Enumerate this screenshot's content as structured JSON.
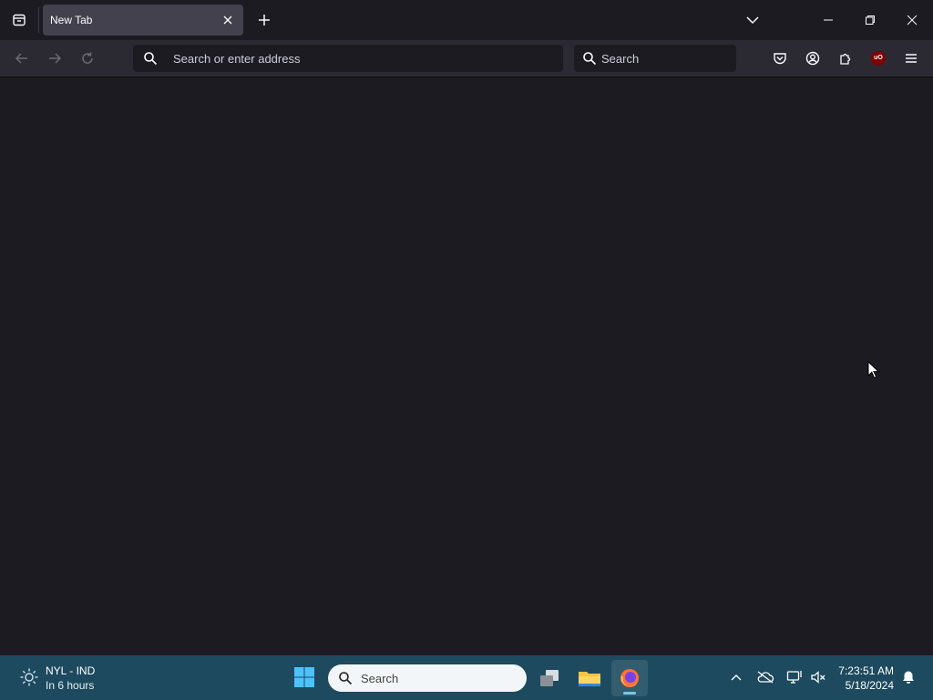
{
  "browser": {
    "tab": {
      "title": "New Tab"
    },
    "urlbar": {
      "placeholder": "Search or enter address"
    },
    "searchbar": {
      "placeholder": "Search"
    },
    "extensions": {
      "ublock_label": "uO"
    }
  },
  "taskbar": {
    "weather": {
      "title": "NYL - IND",
      "subtitle": "In 6 hours"
    },
    "search_label": "Search",
    "clock": {
      "time": "7:23:51 AM",
      "date": "5/18/2024"
    }
  },
  "colors": {
    "browser_bg": "#1c1b22",
    "toolbar_bg": "#2b2a33",
    "active_tab": "#42414d",
    "taskbar_bg": "#1d4a5f",
    "ublock_red": "#800000"
  }
}
